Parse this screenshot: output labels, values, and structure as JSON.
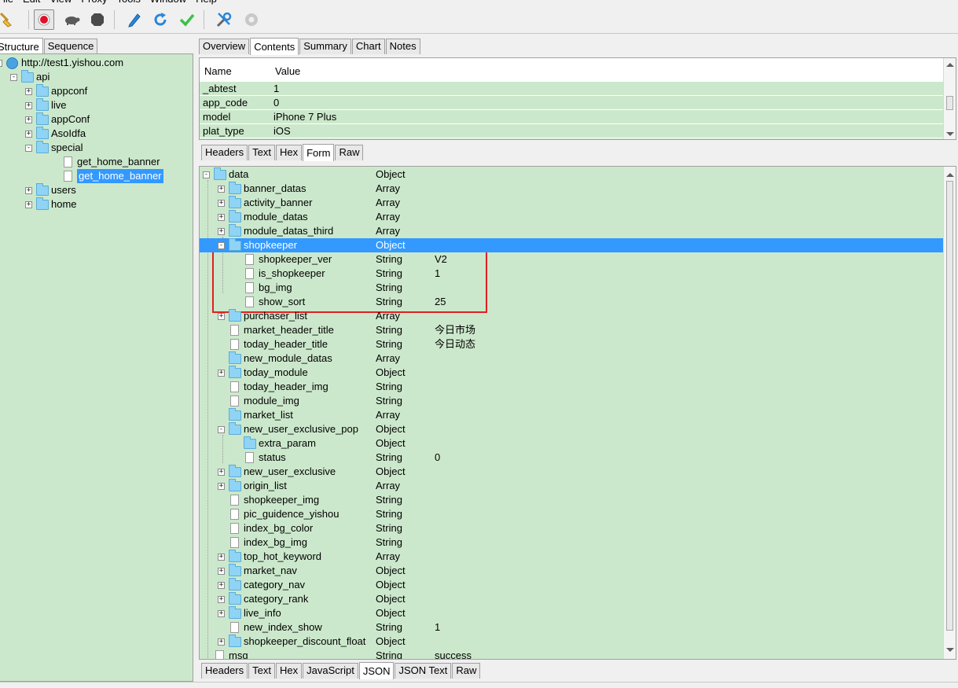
{
  "menubar": {
    "items": [
      "File",
      "Edit",
      "View",
      "Proxy",
      "Tools",
      "Window",
      "Help"
    ]
  },
  "toolbar": {
    "icons": [
      "broom-icon",
      "record-icon",
      "turtle-icon",
      "stop-icon",
      "pen-icon",
      "refresh-icon",
      "check-icon",
      "tools-icon",
      "settings-icon"
    ]
  },
  "left": {
    "tabs": [
      "Structure",
      "Sequence"
    ],
    "host": "http://test1.yishou.com",
    "tree": [
      {
        "label": "api",
        "indent": 1,
        "exp": "-",
        "icon": "folder"
      },
      {
        "label": "appconf",
        "indent": 2,
        "exp": "+",
        "icon": "folder"
      },
      {
        "label": "live",
        "indent": 2,
        "exp": "+",
        "icon": "folder"
      },
      {
        "label": "appConf",
        "indent": 2,
        "exp": "+",
        "icon": "folder"
      },
      {
        "label": "AsoIdfa",
        "indent": 2,
        "exp": "+",
        "icon": "folder"
      },
      {
        "label": "special",
        "indent": 2,
        "exp": "-",
        "icon": "folder"
      },
      {
        "label": "get_home_banner",
        "indent": 3,
        "exp": "",
        "icon": "file"
      },
      {
        "label": "get_home_banner",
        "indent": 3,
        "exp": "",
        "icon": "file",
        "selected": true
      },
      {
        "label": "users",
        "indent": 2,
        "exp": "+",
        "icon": "folder"
      },
      {
        "label": "home",
        "indent": 2,
        "exp": "+",
        "icon": "folder"
      }
    ]
  },
  "right": {
    "top_tabs": [
      "Overview",
      "Contents",
      "Summary",
      "Chart",
      "Notes"
    ],
    "request_table": {
      "headers": [
        "Name",
        "Value"
      ],
      "rows": [
        [
          "_abtest",
          "1"
        ],
        [
          "app_code",
          "0"
        ],
        [
          "model",
          "iPhone 7 Plus"
        ],
        [
          "plat_type",
          "iOS"
        ]
      ]
    },
    "request_tabs": [
      "Headers",
      "Text",
      "Hex",
      "Form",
      "Raw"
    ],
    "json_tree": [
      {
        "name": "data",
        "type": "Object",
        "value": "",
        "level": 0,
        "exp": "-",
        "icon": "folder"
      },
      {
        "name": "banner_datas",
        "type": "Array",
        "value": "",
        "level": 1,
        "exp": "+",
        "icon": "folder"
      },
      {
        "name": "activity_banner",
        "type": "Array",
        "value": "",
        "level": 1,
        "exp": "+",
        "icon": "folder"
      },
      {
        "name": "module_datas",
        "type": "Array",
        "value": "",
        "level": 1,
        "exp": "+",
        "icon": "folder"
      },
      {
        "name": "module_datas_third",
        "type": "Array",
        "value": "",
        "level": 1,
        "exp": "+",
        "icon": "folder"
      },
      {
        "name": "shopkeeper",
        "type": "Object",
        "value": "",
        "level": 1,
        "exp": "-",
        "icon": "folder",
        "selected": true
      },
      {
        "name": "shopkeeper_ver",
        "type": "String",
        "value": "V2",
        "level": 2,
        "exp": "",
        "icon": "file"
      },
      {
        "name": "is_shopkeeper",
        "type": "String",
        "value": "1",
        "level": 2,
        "exp": "",
        "icon": "file"
      },
      {
        "name": "bg_img",
        "type": "String",
        "value": "",
        "level": 2,
        "exp": "",
        "icon": "file"
      },
      {
        "name": "show_sort",
        "type": "String",
        "value": "25",
        "level": 2,
        "exp": "",
        "icon": "file"
      },
      {
        "name": "purchaser_list",
        "type": "Array",
        "value": "",
        "level": 1,
        "exp": "+",
        "icon": "folder"
      },
      {
        "name": "market_header_title",
        "type": "String",
        "value": "今日市场",
        "level": 1,
        "exp": "",
        "icon": "file"
      },
      {
        "name": "today_header_title",
        "type": "String",
        "value": "今日动态",
        "level": 1,
        "exp": "",
        "icon": "file"
      },
      {
        "name": "new_module_datas",
        "type": "Array",
        "value": "",
        "level": 1,
        "exp": "",
        "icon": "folder"
      },
      {
        "name": "today_module",
        "type": "Object",
        "value": "",
        "level": 1,
        "exp": "+",
        "icon": "folder"
      },
      {
        "name": "today_header_img",
        "type": "String",
        "value": "",
        "level": 1,
        "exp": "",
        "icon": "file"
      },
      {
        "name": "module_img",
        "type": "String",
        "value": "",
        "level": 1,
        "exp": "",
        "icon": "file"
      },
      {
        "name": "market_list",
        "type": "Array",
        "value": "",
        "level": 1,
        "exp": "",
        "icon": "folder"
      },
      {
        "name": "new_user_exclusive_pop",
        "type": "Object",
        "value": "",
        "level": 1,
        "exp": "-",
        "icon": "folder"
      },
      {
        "name": "extra_param",
        "type": "Object",
        "value": "",
        "level": 2,
        "exp": "",
        "icon": "folder"
      },
      {
        "name": "status",
        "type": "String",
        "value": "0",
        "level": 2,
        "exp": "",
        "icon": "file"
      },
      {
        "name": "new_user_exclusive",
        "type": "Object",
        "value": "",
        "level": 1,
        "exp": "+",
        "icon": "folder"
      },
      {
        "name": "origin_list",
        "type": "Array",
        "value": "",
        "level": 1,
        "exp": "+",
        "icon": "folder"
      },
      {
        "name": "shopkeeper_img",
        "type": "String",
        "value": "",
        "level": 1,
        "exp": "",
        "icon": "file"
      },
      {
        "name": "pic_guidence_yishou",
        "type": "String",
        "value": "",
        "level": 1,
        "exp": "",
        "icon": "file"
      },
      {
        "name": "index_bg_color",
        "type": "String",
        "value": "",
        "level": 1,
        "exp": "",
        "icon": "file"
      },
      {
        "name": "index_bg_img",
        "type": "String",
        "value": "",
        "level": 1,
        "exp": "",
        "icon": "file"
      },
      {
        "name": "top_hot_keyword",
        "type": "Array",
        "value": "",
        "level": 1,
        "exp": "+",
        "icon": "folder"
      },
      {
        "name": "market_nav",
        "type": "Object",
        "value": "",
        "level": 1,
        "exp": "+",
        "icon": "folder"
      },
      {
        "name": "category_nav",
        "type": "Object",
        "value": "",
        "level": 1,
        "exp": "+",
        "icon": "folder"
      },
      {
        "name": "category_rank",
        "type": "Object",
        "value": "",
        "level": 1,
        "exp": "+",
        "icon": "folder"
      },
      {
        "name": "live_info",
        "type": "Object",
        "value": "",
        "level": 1,
        "exp": "+",
        "icon": "folder"
      },
      {
        "name": "new_index_show",
        "type": "String",
        "value": "1",
        "level": 1,
        "exp": "",
        "icon": "file"
      },
      {
        "name": "shopkeeper_discount_float",
        "type": "Object",
        "value": "",
        "level": 1,
        "exp": "+",
        "icon": "folder"
      },
      {
        "name": "msg",
        "type": "String",
        "value": "success",
        "level": 0,
        "exp": "",
        "icon": "file"
      }
    ],
    "response_tabs": [
      "Headers",
      "Text",
      "Hex",
      "JavaScript",
      "JSON",
      "JSON Text",
      "Raw"
    ]
  },
  "colors": {
    "green": "#cce8cc",
    "selection": "#3399ff",
    "highlight_box": "#e02020"
  }
}
